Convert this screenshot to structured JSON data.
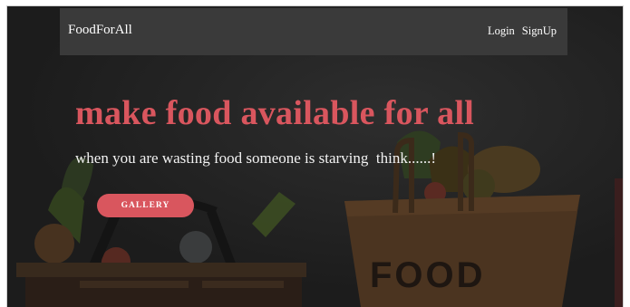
{
  "navbar": {
    "brand": "FoodForAll",
    "links": [
      {
        "label": "Login"
      },
      {
        "label": "SignUp"
      }
    ]
  },
  "hero": {
    "headline": "make food available for all",
    "subline": "when you are wasting food someone is starving  think......!",
    "gallery_button": "GALLERY",
    "bag_text": "FOOD"
  },
  "colors": {
    "accent": "#d9565e",
    "navbar_bg": "#3a3a3a",
    "page_bg": "#202020"
  }
}
